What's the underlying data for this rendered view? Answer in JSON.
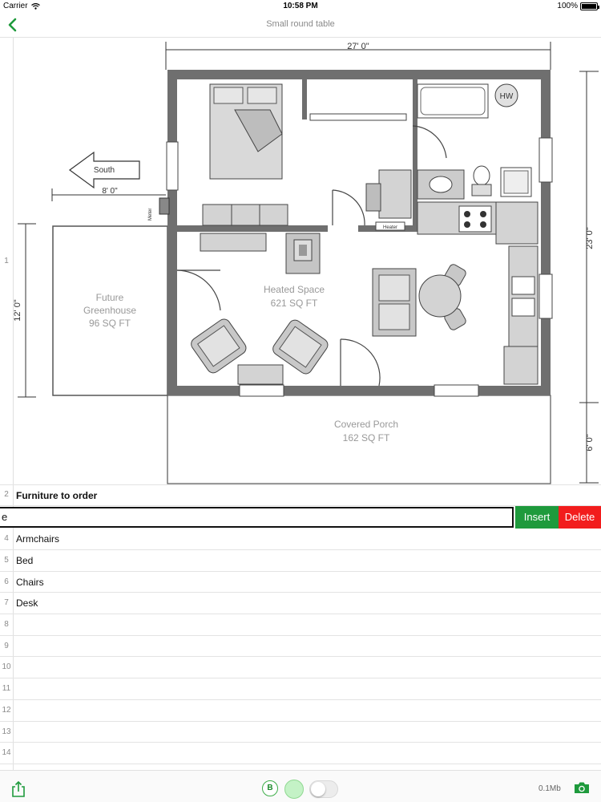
{
  "status_bar": {
    "carrier": "Carrier",
    "time": "10:58 PM",
    "battery": "100%"
  },
  "nav": {
    "title": "Small round table"
  },
  "rows": [
    {
      "num": "1",
      "text": ""
    },
    {
      "num": "2",
      "text": "Furniture to order"
    },
    {
      "num": "3",
      "text": ""
    },
    {
      "num": "4",
      "text": "Armchairs"
    },
    {
      "num": "5",
      "text": "Bed"
    },
    {
      "num": "6",
      "text": "Chairs"
    },
    {
      "num": "7",
      "text": "Desk"
    },
    {
      "num": "8",
      "text": ""
    },
    {
      "num": "9",
      "text": ""
    },
    {
      "num": "10",
      "text": ""
    },
    {
      "num": "11",
      "text": ""
    },
    {
      "num": "12",
      "text": ""
    },
    {
      "num": "13",
      "text": ""
    },
    {
      "num": "14",
      "text": ""
    }
  ],
  "edit": {
    "value": "e",
    "insert_label": "Insert",
    "delete_label": "Delete"
  },
  "floorplan": {
    "dim_top": "27' 0\"",
    "dim_right_main": "23' 0\"",
    "dim_right_porch": "6' 0\"",
    "dim_left": "12' 0\"",
    "dim_small": "8' 0\"",
    "south": "South",
    "meter": "Meter",
    "heater": "Heater",
    "hw": "HW",
    "heated_1": "Heated Space",
    "heated_2": "621 SQ FT",
    "greenhouse_1": "Future",
    "greenhouse_2": "Greenhouse",
    "greenhouse_3": "96 SQ FT",
    "porch_1": "Covered Porch",
    "porch_2": "162 SQ FT"
  },
  "toolbar": {
    "b_label": "B",
    "size": "0.1Mb"
  },
  "icons": [
    "wifi-icon",
    "back-chevron-icon",
    "share-icon",
    "camera-icon"
  ],
  "colors": {
    "accent_green": "#1e9a3c",
    "delete_red": "#f21d1d",
    "wall_gray": "#6f6f6f"
  }
}
